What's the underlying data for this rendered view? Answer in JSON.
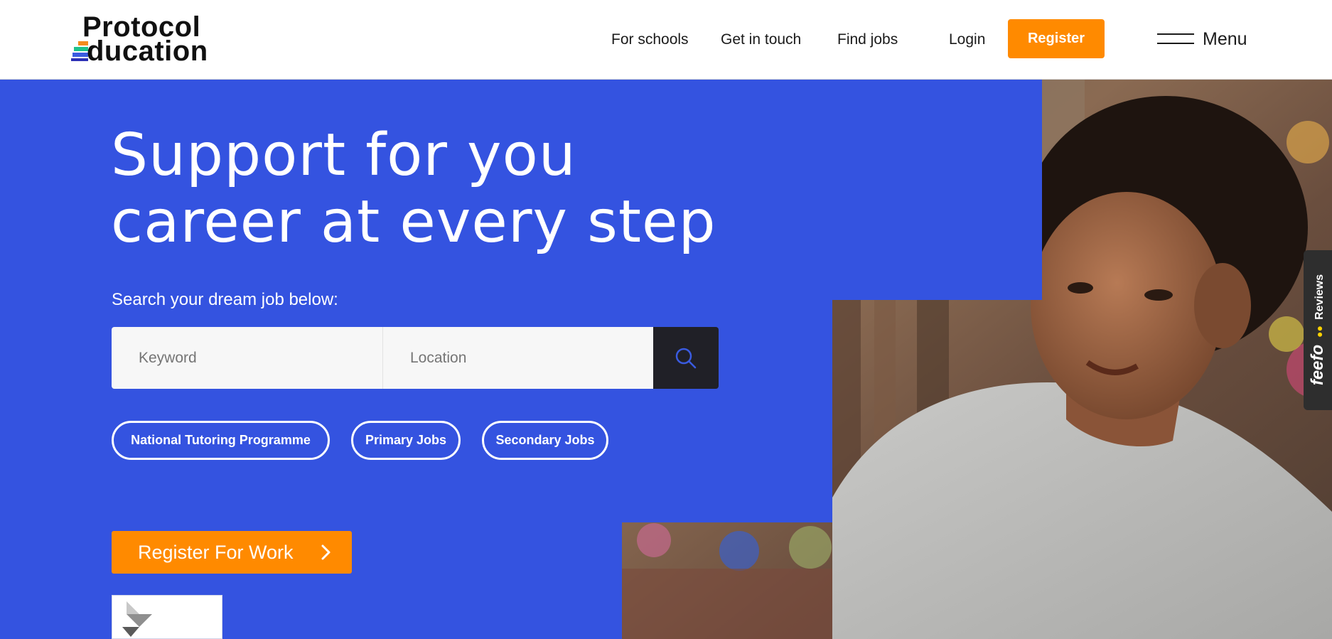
{
  "header": {
    "logo": {
      "line1": "Protocol",
      "line2": "Education"
    },
    "nav": [
      {
        "label": "For schools"
      },
      {
        "label": "Get in touch"
      },
      {
        "label": "Find jobs"
      },
      {
        "label": "Login"
      }
    ],
    "register_label": "Register",
    "menu_label": "Menu"
  },
  "hero": {
    "title_line1": "Support for you",
    "title_line2": "career at every step",
    "search_label": "Search your dream job below:",
    "keyword_placeholder": "Keyword",
    "location_placeholder": "Location",
    "search_icon": "search-icon",
    "quick_links": [
      {
        "label": "National Tutoring Programme"
      },
      {
        "label": "Primary Jobs"
      },
      {
        "label": "Secondary Jobs"
      }
    ],
    "cta_label": "Register For Work",
    "cta_icon": "chevron-right-icon"
  },
  "feefo": {
    "brand": "feefo",
    "label": "Reviews"
  },
  "colors": {
    "hero_blue": "#3453e0",
    "accent_orange": "#ff8a00",
    "search_button": "#202027",
    "text_dark": "#1b1b1b"
  }
}
